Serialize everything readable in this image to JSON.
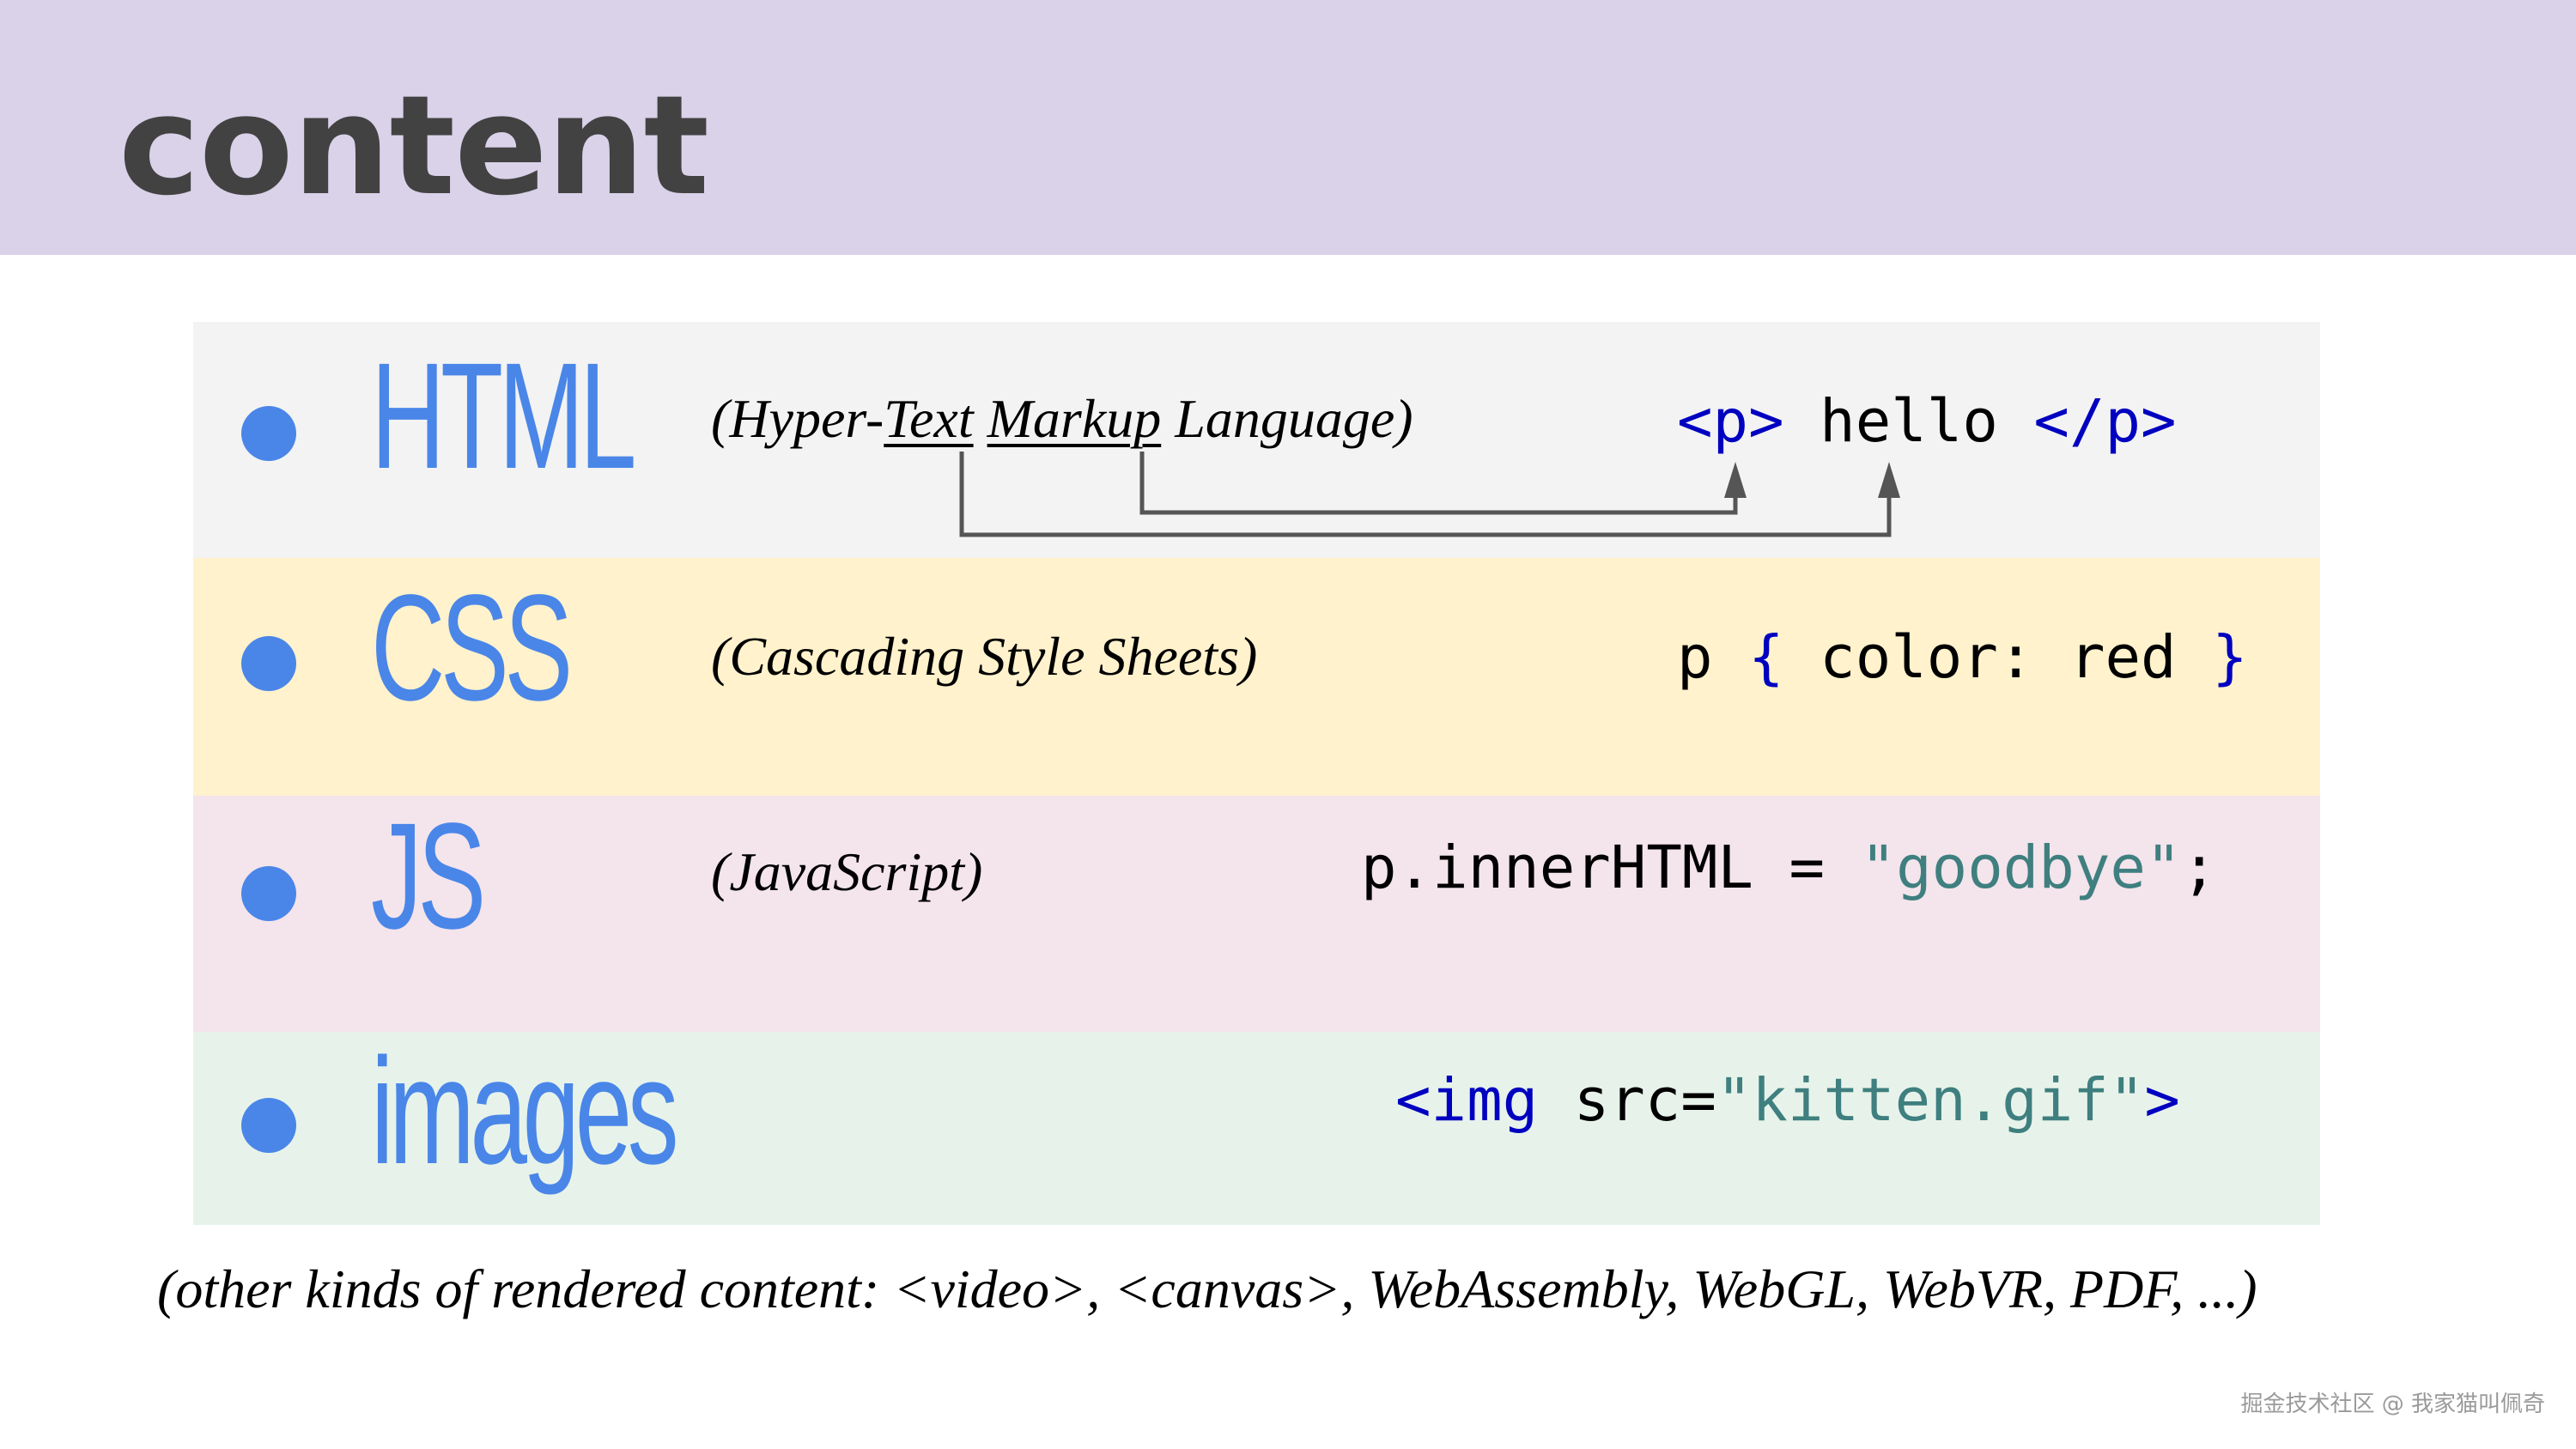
{
  "header": {
    "title": "content"
  },
  "rows": [
    {
      "name": "HTML",
      "description": {
        "before": "(Hyper-",
        "underline1": "Text",
        "space": " ",
        "underline2": "Markup",
        "after": " Language)"
      },
      "code": {
        "open_tag": "<p>",
        "text": " hello ",
        "close_tag": "</p>"
      }
    },
    {
      "name": "CSS",
      "description": "(Cascading Style Sheets)",
      "code": {
        "selector": "p ",
        "open_brace": "{",
        "decl": " color: red ",
        "close_brace": "}"
      }
    },
    {
      "name": "JS",
      "description": "(JavaScript)",
      "code": {
        "lhs": "p.innerHTML = ",
        "string": "\"goodbye\"",
        "end": ";"
      }
    },
    {
      "name": "images",
      "code": {
        "tag_open": "<img",
        "attr": " src=",
        "value": "\"kitten.gif\"",
        "tag_close": ">"
      }
    }
  ],
  "footnote": "(other kinds of rendered content: <video>, <canvas>, WebAssembly, WebGL, WebVR, PDF, ...)",
  "watermark": "掘金技术社区 @ 我家猫叫佩奇",
  "colors": {
    "header_bg": "#d9d2e9",
    "accent": "#4a86e8",
    "html_band": "#f3f3f3",
    "css_band": "#fff2cc",
    "js_band": "#f4e4ec",
    "images_band": "#e7f3ea",
    "keyword": "#0000c0",
    "string": "#3f7f7f"
  }
}
